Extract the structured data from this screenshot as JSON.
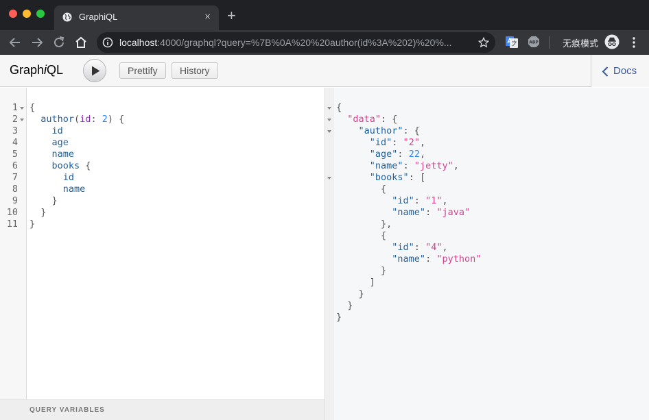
{
  "browser": {
    "tab_title": "GraphiQL",
    "tab_close": "×",
    "new_tab": "+",
    "url_host": "localhost",
    "url_rest": ":4000/graphql?query=%7B%0A%20%20author(id%3A%202)%20%...",
    "incognito_label": "无痕模式"
  },
  "graphiql": {
    "logo_prefix": "Graph",
    "logo_i": "i",
    "logo_suffix": "QL",
    "prettify_label": "Prettify",
    "history_label": "History",
    "docs_label": "Docs",
    "query_variables_label": "QUERY VARIABLES"
  },
  "query_lines": [
    [
      [
        "{",
        "punc"
      ]
    ],
    [
      [
        "  ",
        "punc"
      ],
      [
        "author",
        "field"
      ],
      [
        "(",
        "punc"
      ],
      [
        "id",
        "arg"
      ],
      [
        ": ",
        "punc"
      ],
      [
        "2",
        "num"
      ],
      [
        ") {",
        "punc"
      ]
    ],
    [
      [
        "    ",
        "punc"
      ],
      [
        "id",
        "field"
      ]
    ],
    [
      [
        "    ",
        "punc"
      ],
      [
        "age",
        "field"
      ]
    ],
    [
      [
        "    ",
        "punc"
      ],
      [
        "name",
        "field"
      ]
    ],
    [
      [
        "    ",
        "punc"
      ],
      [
        "books",
        "field"
      ],
      [
        " {",
        "punc"
      ]
    ],
    [
      [
        "      ",
        "punc"
      ],
      [
        "id",
        "field"
      ]
    ],
    [
      [
        "      ",
        "punc"
      ],
      [
        "name",
        "field"
      ]
    ],
    [
      [
        "    }",
        "punc"
      ]
    ],
    [
      [
        "  }",
        "punc"
      ]
    ],
    [
      [
        "}",
        "punc"
      ]
    ]
  ],
  "result_lines": [
    [
      [
        "{",
        "punc"
      ]
    ],
    [
      [
        "  ",
        "punc"
      ],
      [
        "\"data\"",
        "data"
      ],
      [
        ": {",
        "punc"
      ]
    ],
    [
      [
        "    ",
        "punc"
      ],
      [
        "\"author\"",
        "prop"
      ],
      [
        ": {",
        "punc"
      ]
    ],
    [
      [
        "      ",
        "punc"
      ],
      [
        "\"id\"",
        "prop"
      ],
      [
        ": ",
        "punc"
      ],
      [
        "\"2\"",
        "str"
      ],
      [
        ",",
        "punc"
      ]
    ],
    [
      [
        "      ",
        "punc"
      ],
      [
        "\"age\"",
        "prop"
      ],
      [
        ": ",
        "punc"
      ],
      [
        "22",
        "num"
      ],
      [
        ",",
        "punc"
      ]
    ],
    [
      [
        "      ",
        "punc"
      ],
      [
        "\"name\"",
        "prop"
      ],
      [
        ": ",
        "punc"
      ],
      [
        "\"jetty\"",
        "str"
      ],
      [
        ",",
        "punc"
      ]
    ],
    [
      [
        "      ",
        "punc"
      ],
      [
        "\"books\"",
        "prop"
      ],
      [
        ": [",
        "punc"
      ]
    ],
    [
      [
        "        {",
        "punc"
      ]
    ],
    [
      [
        "          ",
        "punc"
      ],
      [
        "\"id\"",
        "prop"
      ],
      [
        ": ",
        "punc"
      ],
      [
        "\"1\"",
        "str"
      ],
      [
        ",",
        "punc"
      ]
    ],
    [
      [
        "          ",
        "punc"
      ],
      [
        "\"name\"",
        "prop"
      ],
      [
        ": ",
        "punc"
      ],
      [
        "\"java\"",
        "str"
      ]
    ],
    [
      [
        "        },",
        "punc"
      ]
    ],
    [
      [
        "        {",
        "punc"
      ]
    ],
    [
      [
        "          ",
        "punc"
      ],
      [
        "\"id\"",
        "prop"
      ],
      [
        ": ",
        "punc"
      ],
      [
        "\"4\"",
        "str"
      ],
      [
        ",",
        "punc"
      ]
    ],
    [
      [
        "          ",
        "punc"
      ],
      [
        "\"name\"",
        "prop"
      ],
      [
        ": ",
        "punc"
      ],
      [
        "\"python\"",
        "str"
      ]
    ],
    [
      [
        "        }",
        "punc"
      ]
    ],
    [
      [
        "      ]",
        "punc"
      ]
    ],
    [
      [
        "    }",
        "punc"
      ]
    ],
    [
      [
        "  }",
        "punc"
      ]
    ],
    [
      [
        "}",
        "punc"
      ]
    ]
  ],
  "query_folds": [
    1,
    2
  ],
  "result_folds": [
    1,
    2,
    3,
    7
  ],
  "colors": {
    "field": "#1f61a0",
    "argument": "#8b2bb9",
    "number": "#2882f9",
    "string": "#d64292",
    "docs_link": "#3b5998"
  },
  "icons": {
    "favicon": "globe-icon",
    "back": "arrow-left-icon",
    "forward": "arrow-right-icon",
    "reload": "reload-icon",
    "home": "home-icon",
    "info": "info-icon",
    "bookmark": "star-icon",
    "translate_ext": "google-translate-icon",
    "adblock_ext": "abp-icon",
    "incognito": "incognito-icon",
    "menu": "kebab-menu-icon",
    "execute": "play-icon",
    "docs": "chevron-left-icon"
  }
}
